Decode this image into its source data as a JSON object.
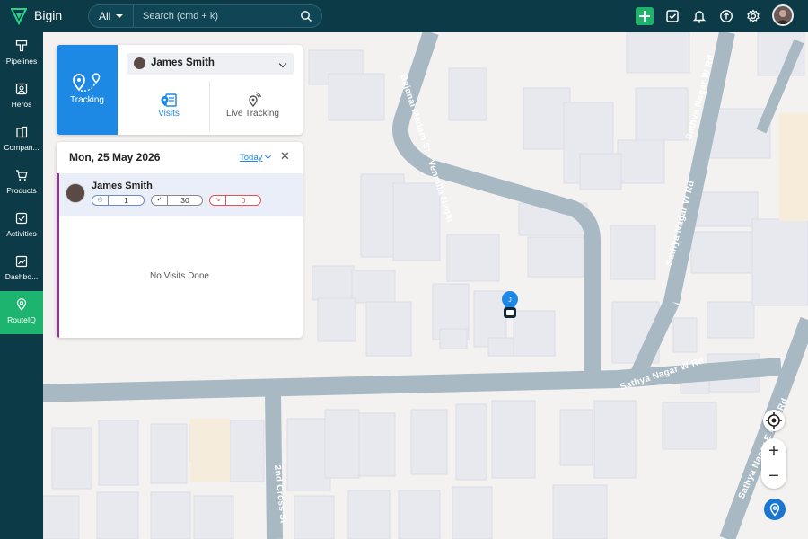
{
  "app": {
    "brand": "Bigin"
  },
  "search": {
    "scope": "All",
    "placeholder": "Search (cmd + k)"
  },
  "sidebar": {
    "items": [
      {
        "label": "Pipelines"
      },
      {
        "label": "Heros"
      },
      {
        "label": "Compan..."
      },
      {
        "label": "Products"
      },
      {
        "label": "Activities"
      },
      {
        "label": "Dashbo..."
      },
      {
        "label": "RouteIQ"
      }
    ]
  },
  "tracking": {
    "tile_label": "Tracking",
    "selected_user": "James Smith",
    "tabs": [
      {
        "label": "Visits"
      },
      {
        "label": "Live Tracking"
      }
    ]
  },
  "visits": {
    "date": "Mon, 25 May 2026",
    "filter_label": "Today",
    "user": {
      "name": "James Smith",
      "stats": {
        "planned": "1",
        "completed": "30",
        "missed": "0"
      }
    },
    "empty_message": "No Visits Done"
  },
  "map": {
    "roads": [
      "Bajanai Madam St - Vennilla Nagar",
      "Sathya Nagar W Rd",
      "Sathya Nagar W Rd",
      "Sathya Nagar W Rd",
      "2nd Cross St",
      "Sathya Nagar E Main Rd"
    ],
    "marker_initial": "J"
  },
  "colors": {
    "accent": "#1e88e5",
    "nav_bg": "#0d3a47",
    "active": "#1db46f"
  }
}
